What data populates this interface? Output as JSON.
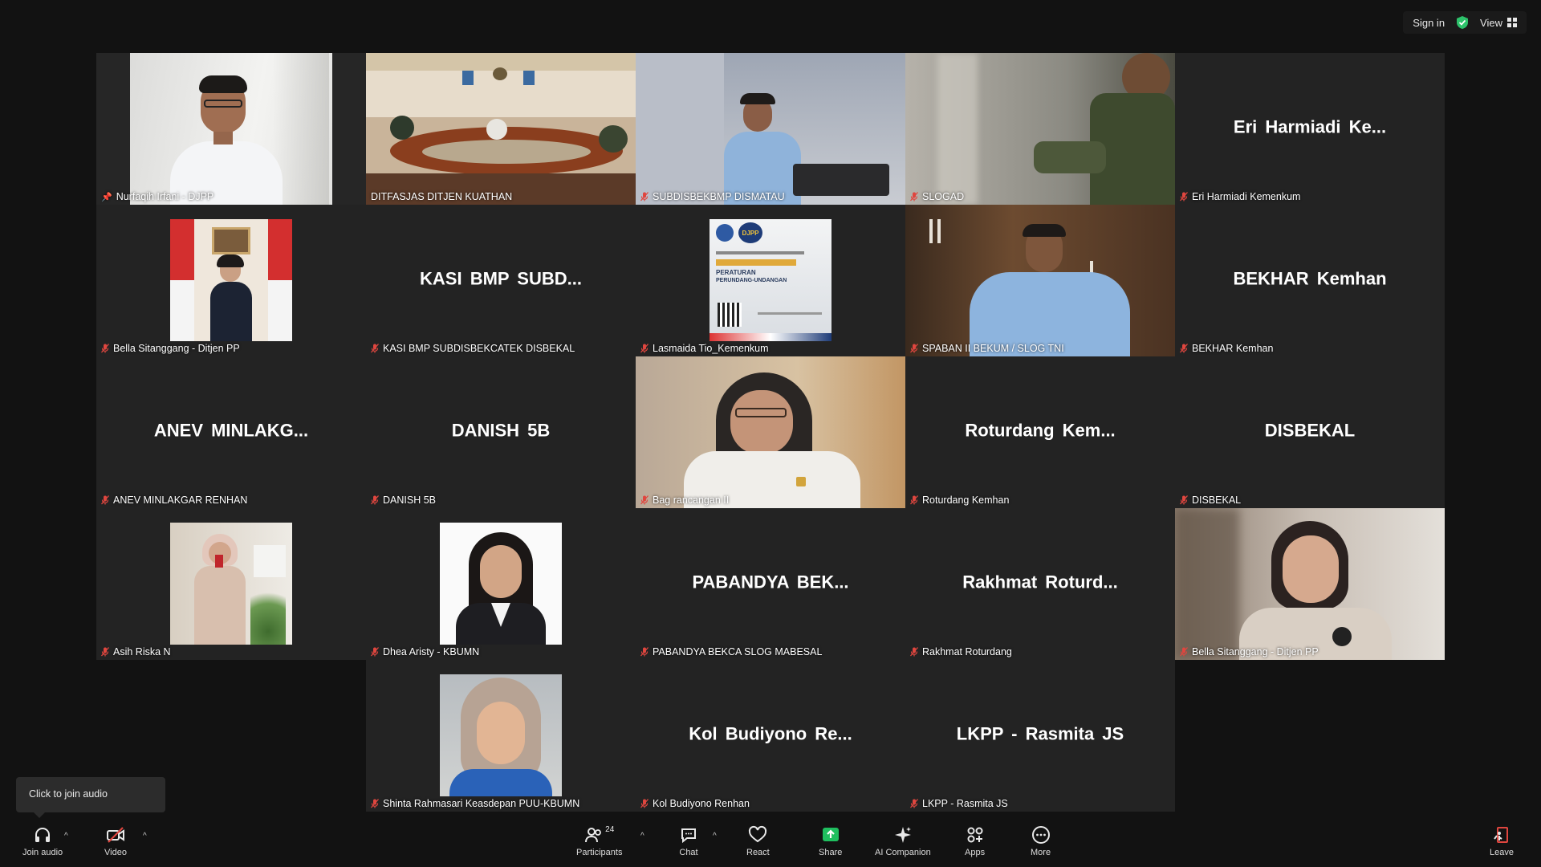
{
  "top_bar": {
    "sign_in": "Sign in",
    "view": "View"
  },
  "participants_tiles": [
    {
      "label": "Nurfaqih Irfani - DJPP",
      "kind": "video",
      "pinned": true,
      "active": true
    },
    {
      "label": "DITFASJAS DITJEN KUATHAN",
      "kind": "video"
    },
    {
      "label": "SUBDISBEKBMP DISMATAU",
      "kind": "video"
    },
    {
      "label": "SLOGAD",
      "kind": "video"
    },
    {
      "label": "Eri Harmiadi Kemenkum",
      "display": "Eri Harmiadi Ke...",
      "kind": "name"
    },
    {
      "label": "Bella Sitanggang - Ditjen PP",
      "kind": "photo"
    },
    {
      "label": "KASI BMP SUBDISBEKCATEK DISBEKAL",
      "display": "KASI BMP SUBD...",
      "kind": "name"
    },
    {
      "label": "Lasmaida Tio_Kemenkum",
      "kind": "photo"
    },
    {
      "label": "SPABAN II BEKUM / SLOG TNI",
      "kind": "video"
    },
    {
      "label": "BEKHAR Kemhan",
      "display": "BEKHAR Kemhan",
      "kind": "name"
    },
    {
      "label": "ANEV MINLAKGAR RENHAN",
      "display": "ANEV MINLAKG...",
      "kind": "name"
    },
    {
      "label": "DANISH 5B",
      "display": "DANISH 5B",
      "kind": "name"
    },
    {
      "label": "Bag rancangan II",
      "kind": "video"
    },
    {
      "label": "Roturdang Kemhan",
      "display": "Roturdang Kem...",
      "kind": "name"
    },
    {
      "label": "DISBEKAL",
      "display": "DISBEKAL",
      "kind": "name"
    },
    {
      "label": "Asih Riska N",
      "kind": "photo"
    },
    {
      "label": "Dhea Aristy - KBUMN",
      "kind": "photo"
    },
    {
      "label": "PABANDYA BEKCA SLOG MABESAL",
      "display": "PABANDYA BEK...",
      "kind": "name"
    },
    {
      "label": "Rakhmat Roturdang",
      "display": "Rakhmat Roturd...",
      "kind": "name"
    },
    {
      "label": "Bella Sitanggang - Ditjen PP",
      "kind": "video"
    },
    {
      "label": "Shinta Rahmasari Keasdepan PUU-KBUMN",
      "kind": "photo"
    },
    {
      "label": "Kol Budiyono Renhan",
      "display": "Kol Budiyono Re...",
      "kind": "name"
    },
    {
      "label": "LKPP - Rasmita JS",
      "display": "LKPP - Rasmita JS",
      "kind": "name"
    }
  ],
  "poster": {
    "line1": "PERATURAN",
    "line2": "PERUNDANG-UNDANGAN",
    "logo": "DJPP"
  },
  "tooltip": {
    "text": "Click to join audio"
  },
  "toolbar": {
    "join_audio": "Join audio",
    "video": "Video",
    "participants": "Participants",
    "participants_count": "24",
    "chat": "Chat",
    "react": "React",
    "share": "Share",
    "ai_companion": "AI Companion",
    "apps": "Apps",
    "more": "More",
    "leave": "Leave"
  },
  "colors": {
    "active_border": "#2dd47a",
    "share_green": "#1fbf5f",
    "mic_red": "#e0463f",
    "leave_red": "#e0463f"
  }
}
